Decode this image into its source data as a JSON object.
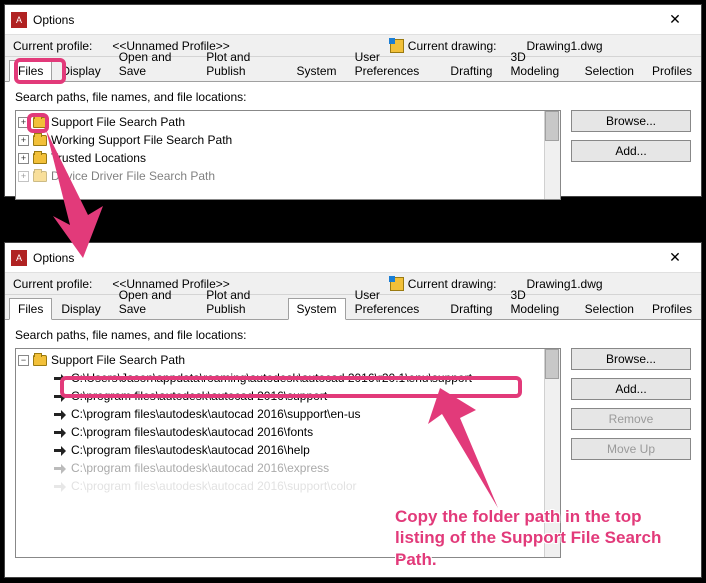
{
  "window": {
    "title": "Options",
    "close_glyph": "✕"
  },
  "profilebar": {
    "current_profile_label": "Current profile:",
    "current_profile_value": "<<Unnamed Profile>>",
    "current_drawing_label": "Current drawing:",
    "current_drawing_value": "Drawing1.dwg"
  },
  "tabs": [
    "Files",
    "Display",
    "Open and Save",
    "Plot and Publish",
    "System",
    "User Preferences",
    "Drafting",
    "3D Modeling",
    "Selection",
    "Profiles"
  ],
  "search_label": "Search paths, file names, and file locations:",
  "expand_plus": "+",
  "expand_minus": "−",
  "top_tree": {
    "items": [
      "Support File Search Path",
      "Working Support File Search Path",
      "Trusted Locations",
      "Device Driver File Search Path"
    ]
  },
  "bottom_tree": {
    "root": "Support File Search Path",
    "paths": [
      "C:\\Users\\Jason\\appdata\\roaming\\autodesk\\autocad 2016\\r20.1\\enu\\support",
      "C:\\program files\\autodesk\\autocad 2016\\support",
      "C:\\program files\\autodesk\\autocad 2016\\support\\en-us",
      "C:\\program files\\autodesk\\autocad 2016\\fonts",
      "C:\\program files\\autodesk\\autocad 2016\\help",
      "C:\\program files\\autodesk\\autocad 2016\\express",
      "C:\\program files\\autodesk\\autocad 2016\\support\\color"
    ]
  },
  "buttons": {
    "browse": "Browse...",
    "add": "Add...",
    "remove": "Remove",
    "moveup": "Move Up"
  },
  "annotation": "Copy the folder path in the top listing of the Support File Search Path."
}
